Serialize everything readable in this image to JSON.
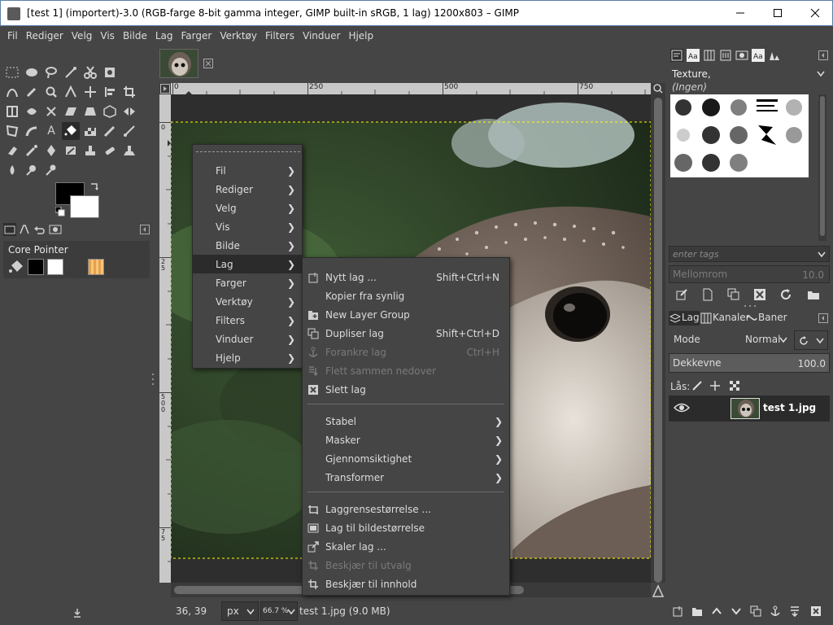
{
  "window": {
    "title": "[test 1] (importert)-3.0 (RGB-farge 8-bit gamma integer, GIMP built-in sRGB, 1 lag) 1200x803 – GIMP",
    "minimize": "—",
    "maximize": "☐",
    "close": "✕"
  },
  "menubar": [
    "Fil",
    "Rediger",
    "Velg",
    "Vis",
    "Bilde",
    "Lag",
    "Farger",
    "Verktøy",
    "Filters",
    "Vinduer",
    "Hjelp"
  ],
  "toolbox": {
    "device_status_title": "Core Pointer"
  },
  "rulers": {
    "h": [
      "0",
      "250",
      "500",
      "750"
    ],
    "v": [
      "0",
      "2",
      "5",
      "5",
      "0",
      "0",
      "7",
      "5"
    ]
  },
  "context_menu": {
    "items": [
      "Fil",
      "Rediger",
      "Velg",
      "Vis",
      "Bilde",
      "Lag",
      "Farger",
      "Verktøy",
      "Filters",
      "Vinduer",
      "Hjelp"
    ],
    "highlighted": "Lag"
  },
  "lag_submenu": {
    "group1": [
      {
        "label": "Nytt lag ...",
        "accel": "Shift+Ctrl+N",
        "enabled": true,
        "icon": "new-layer-icon"
      },
      {
        "label": "Kopier fra synlig",
        "accel": "",
        "enabled": true,
        "icon": ""
      },
      {
        "label": "New Layer Group",
        "accel": "",
        "enabled": true,
        "icon": "layer-group-icon"
      },
      {
        "label": "Dupliser lag",
        "accel": "Shift+Ctrl+D",
        "enabled": true,
        "icon": "duplicate-layer-icon"
      },
      {
        "label": "Forankre lag",
        "accel": "Ctrl+H",
        "enabled": false,
        "icon": "anchor-icon"
      },
      {
        "label": "Flett sammen nedover",
        "accel": "",
        "enabled": false,
        "icon": "merge-down-icon"
      },
      {
        "label": "Slett lag",
        "accel": "",
        "enabled": true,
        "icon": "delete-icon"
      }
    ],
    "group2": [
      "Stabel",
      "Masker",
      "Gjennomsiktighet",
      "Transformer"
    ],
    "group3": [
      {
        "label": "Laggrensestørrelse ...",
        "enabled": true,
        "icon": "layer-boundary-icon"
      },
      {
        "label": "Lag til bildestørrelse",
        "enabled": true,
        "icon": "layer-to-image-icon"
      },
      {
        "label": "Skaler lag ...",
        "enabled": true,
        "icon": "scale-layer-icon"
      },
      {
        "label": "Beskjær til utvalg",
        "enabled": false,
        "icon": "crop-icon"
      },
      {
        "label": "Beskjær til innhold",
        "enabled": true,
        "icon": "crop-content-icon"
      }
    ]
  },
  "status": {
    "coords": "36, 39",
    "unit": "px",
    "zoom": "66.7 %",
    "file": "test 1.jpg (9.0 MB)"
  },
  "brushes": {
    "name": "Texture,",
    "tag": "(Ingen)",
    "tags_placeholder": "enter tags",
    "spacing_label": "Mellomrom",
    "spacing_value": "10.0"
  },
  "layers": {
    "tabs": [
      "Lag",
      "Kanaler",
      "Baner"
    ],
    "mode_label": "Mode",
    "mode_value": "Normal",
    "opacity_label": "Dekkevne",
    "opacity_value": "100.0",
    "lock_label": "Lås:",
    "layer_name": "test 1.jpg"
  },
  "colors": {
    "bg": "#454545",
    "menu_highlight": "#2b2b2b",
    "fg_swatch": "#000000",
    "bg_swatch": "#ffffff"
  }
}
